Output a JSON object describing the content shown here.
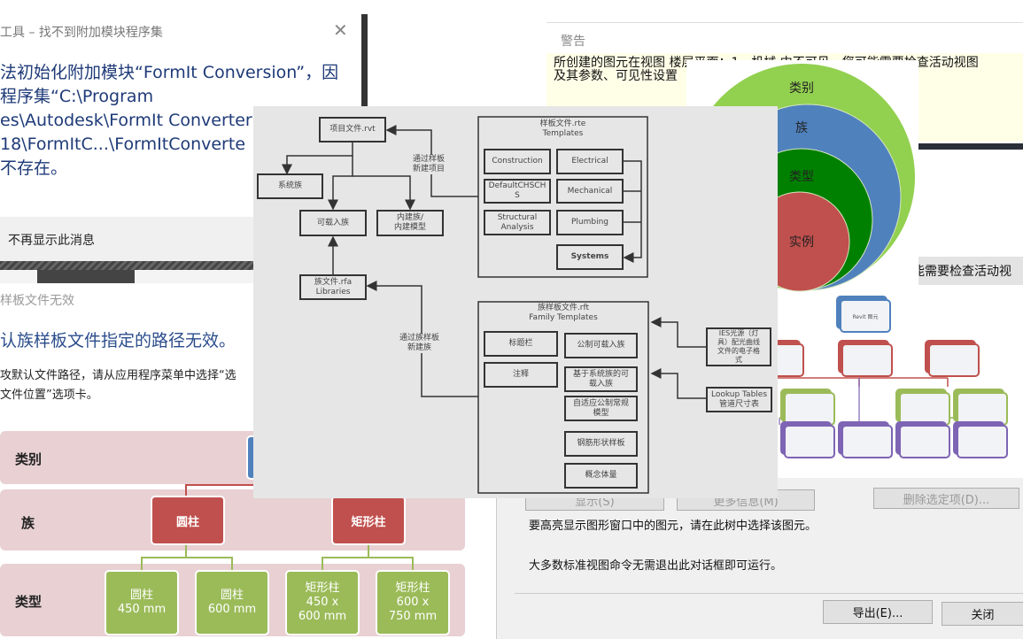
{
  "addin_dialog": {
    "title": "工具 – 找不到附加模块程序集",
    "close_icon": "close-icon",
    "message": "法初始化附加模块“FormIt Conversion”，因\n程序集“C:\\Program\nes\\Autodesk\\FormIt Converter\n18\\FormItC...\\FormItConverte\n不存在。",
    "dont_show_again": "不再显示此消息"
  },
  "template_dialog": {
    "title": "样板文件无效",
    "heading": "认族样板文件指定的路径无效。",
    "text": "攻默认文件路径，请从应用程序菜单中选择“选\n文件位置”选项卡。"
  },
  "hierarchy": {
    "row_labels": [
      "类别",
      "族",
      "类型"
    ],
    "families": [
      "圆柱",
      "矩形柱"
    ],
    "types": [
      "圆柱\n450 mm",
      "圆柱\n600 mm",
      "矩形柱\n450 x\n600 mm",
      "矩形柱\n600 x\n750 mm"
    ],
    "colors": {
      "row": "#e8d0d3",
      "family": "#c0504d",
      "type": "#9bbb59",
      "category": "#4f81bd"
    }
  },
  "warning_dialog": {
    "title": "警告",
    "message": "所创建的图元在视图 楼层平面：1 - 机械 中不可见。您可能需要检查活动视图\n及其参数、可见性设置",
    "behind_text": "能需要检查活动视"
  },
  "circles": {
    "labels": [
      "类别",
      "族",
      "类型",
      "实例"
    ],
    "colors": [
      "#92d050",
      "#4f81bd",
      "#008000",
      "#c0504d"
    ]
  },
  "org_chart": {
    "root": "Revit 图元"
  },
  "review_dialog": {
    "buttons": [
      "显示(S)",
      "更多信息(M)",
      "删除选定项(D)..."
    ],
    "hint1": "要高亮显示图形窗口中的图元，请在此树中选择该图元。",
    "hint2": "大多数标准视图命令无需退出此对话框即可运行。",
    "export": "导出(E)...",
    "close": "关闭"
  },
  "flowchart": {
    "project_file": "项目文件.rvt",
    "system_family": "系统族",
    "loadable_family": "可载入族",
    "inplace_family": "内建族/\n内建模型",
    "family_file": "族文件.rfa\nLibraries",
    "via_template": "通过样板\n新建项目",
    "via_family_template": "通过族样板\n新建族",
    "templates_title": "样板文件.rte\nTemplates",
    "templates": [
      "Construction",
      "Electrical",
      "DefaultCHSCH\nS",
      "Mechanical",
      "Structural\nAnalysis",
      "Plumbing",
      "Systems"
    ],
    "family_templates_title": "族样板文件.rft\nFamily Templates",
    "family_templates": [
      "标题栏",
      "注释",
      "公制可载入族",
      "基于系统族的可\n载入族",
      "自适应公制常规\n模型",
      "钢筋形状样板",
      "概念体量"
    ],
    "ies": "IES光源（灯\n具）配光曲线\n文件的电子格\n式",
    "lookup": "Lookup Tables\n管道尺寸表"
  }
}
